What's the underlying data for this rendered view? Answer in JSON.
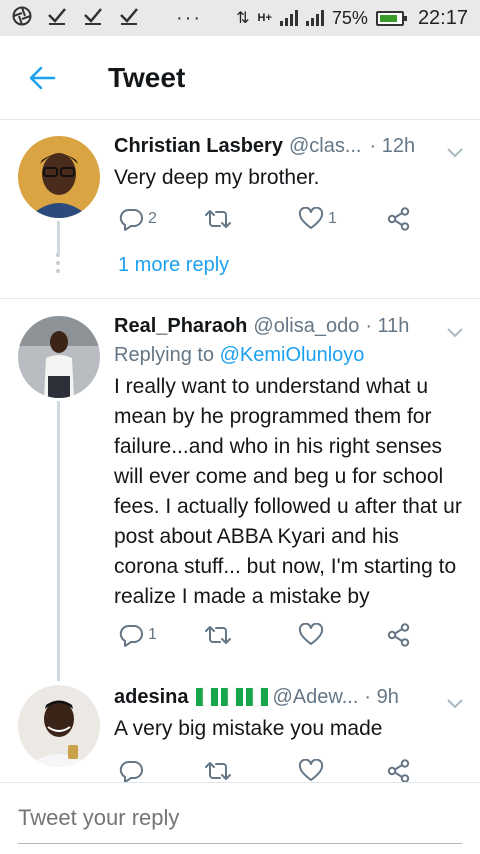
{
  "statusbar": {
    "battery": "75%",
    "time": "22:17",
    "network": "H+"
  },
  "header": {
    "title": "Tweet"
  },
  "tweets": [
    {
      "name": "Christian Lasbery",
      "handle": "@clas...",
      "time": "· 12h",
      "text": "Very deep my brother.",
      "replies": "2",
      "retweets": "",
      "likes": "1",
      "more_reply": "1 more reply"
    },
    {
      "name": "Real_Pharaoh",
      "handle": "@olisa_odo",
      "time": "· 11h",
      "replying_prefix": "Replying to ",
      "replying_to": "@KemiOlunloyo",
      "text": "I really want to understand what u mean by he programmed them for failure...and who in his right senses will ever come and beg u for school fees. I actually followed u after that ur post about ABBA Kyari and his corona stuff... but now, I'm starting to realize I made a mistake by",
      "replies": "1",
      "retweets": "",
      "likes": ""
    },
    {
      "name": "adesina",
      "handle": "@Adew...",
      "time": "· 9h",
      "text": "A very big mistake you made",
      "replies": "",
      "retweets": "",
      "likes": ""
    }
  ],
  "reply_bar": {
    "placeholder": "Tweet your reply"
  },
  "colors": {
    "accent": "#1da1f2",
    "muted": "#657786",
    "text": "#14171a"
  }
}
